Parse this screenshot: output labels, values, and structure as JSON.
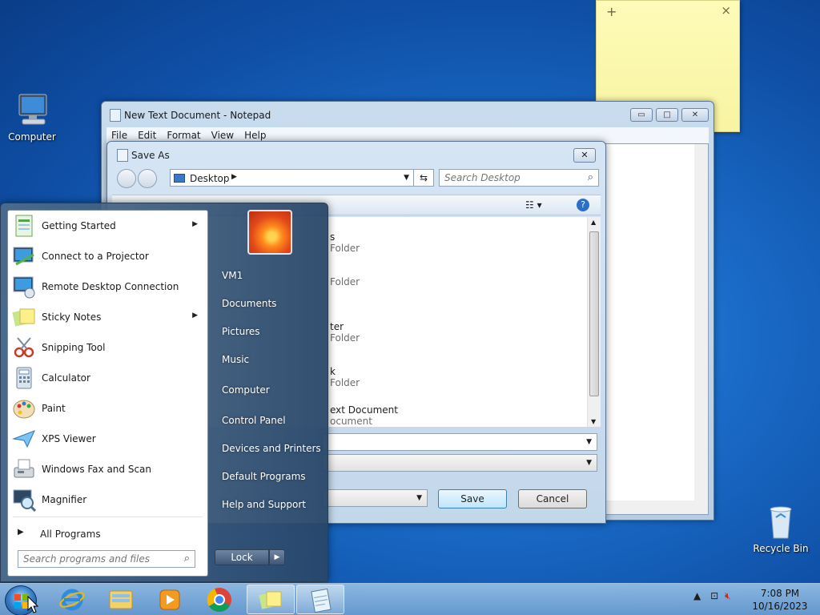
{
  "desktop": {
    "icons": [
      {
        "label": "Computer"
      },
      {
        "label": "Recycle Bin"
      }
    ]
  },
  "sticky_note": {
    "add_glyph": "+",
    "close_glyph": "×"
  },
  "notepad": {
    "title": "New Text Document - Notepad",
    "menu": [
      "File",
      "Edit",
      "Format",
      "View",
      "Help"
    ],
    "min_glyph": "▭",
    "max_glyph": "□",
    "close_glyph": "✕"
  },
  "save_as": {
    "title": "Save As",
    "location": "Desktop",
    "search_placeholder": "Search Desktop",
    "close_glyph": "✕",
    "files": [
      {
        "name": "s",
        "type": "Folder"
      },
      {
        "name": "",
        "type": "Folder"
      },
      {
        "name": "ter",
        "type": "Folder"
      },
      {
        "name": "k",
        "type": "Folder"
      },
      {
        "name": "ext Document",
        "type": "ocument"
      }
    ],
    "save_label": "Save",
    "cancel_label": "Cancel"
  },
  "start_menu": {
    "programs": [
      {
        "label": "Getting Started",
        "icon": "getting-started-icon",
        "submenu": true
      },
      {
        "label": "Connect to a Projector",
        "icon": "projector-icon",
        "submenu": false
      },
      {
        "label": "Remote Desktop Connection",
        "icon": "remote-desktop-icon",
        "submenu": false
      },
      {
        "label": "Sticky Notes",
        "icon": "sticky-notes-icon",
        "submenu": true
      },
      {
        "label": "Snipping Tool",
        "icon": "scissors-icon",
        "submenu": false
      },
      {
        "label": "Calculator",
        "icon": "calculator-icon",
        "submenu": false
      },
      {
        "label": "Paint",
        "icon": "paint-palette-icon",
        "submenu": false
      },
      {
        "label": "XPS Viewer",
        "icon": "xps-viewer-icon",
        "submenu": false
      },
      {
        "label": "Windows Fax and Scan",
        "icon": "fax-icon",
        "submenu": false
      },
      {
        "label": "Magnifier",
        "icon": "magnifier-icon",
        "submenu": false
      }
    ],
    "all_programs": "All Programs",
    "search_placeholder": "Search programs and files",
    "right_links": [
      "VM1",
      "Documents",
      "Pictures",
      "Music",
      "Computer",
      "Control Panel",
      "Devices and Printers",
      "Default Programs",
      "Help and Support"
    ],
    "lock_label": "Lock"
  },
  "taskbar": {
    "pinned": [
      "internet-explorer-icon",
      "file-explorer-icon",
      "media-player-icon",
      "chrome-icon",
      "sticky-notes-icon",
      "notepad-icon"
    ],
    "time": "7:08 PM",
    "date": "10/16/2023"
  }
}
